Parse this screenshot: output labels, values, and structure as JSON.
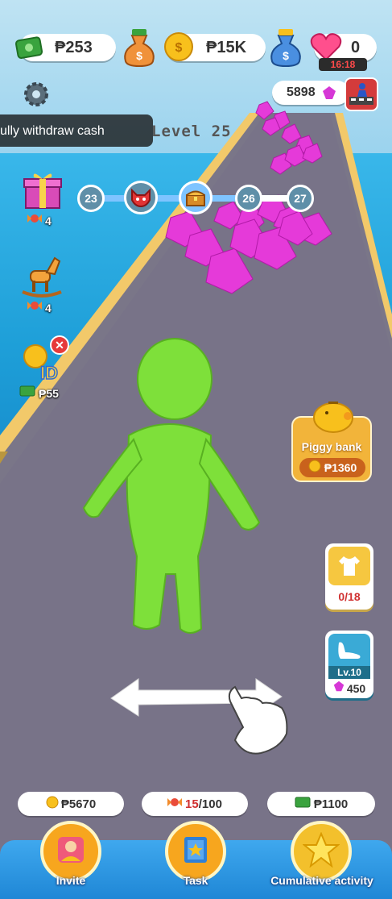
{
  "currency": {
    "cash": "₱253",
    "coins": "₱15K",
    "lives": "0",
    "lives_timer": "16:18",
    "gems": "5898"
  },
  "level": {
    "title": "Level 25",
    "nodes": [
      "23",
      "26",
      "27"
    ]
  },
  "banner": {
    "text": "ully withdraw cash"
  },
  "side_left": {
    "gift_count": "4",
    "horse_count": "4",
    "id_reward": "₱55"
  },
  "side_right": {
    "piggy_label": "Piggy bank",
    "piggy_amount": "₱1360",
    "outfit_progress": "0/18",
    "upgrade_level": "Lv.10",
    "upgrade_cost": "450"
  },
  "bottom": {
    "invite_amount": "₱5670",
    "task_current": "15",
    "task_total": "/100",
    "activity_amount": "₱1100",
    "invite_label": "Invite",
    "task_label": "Task",
    "activity_label": "Cumulative activity"
  },
  "colors": {
    "player": "#7ee03a",
    "gem": "#e53ad9",
    "road": "#7f7b8c",
    "sea": "#1e9fd8"
  }
}
